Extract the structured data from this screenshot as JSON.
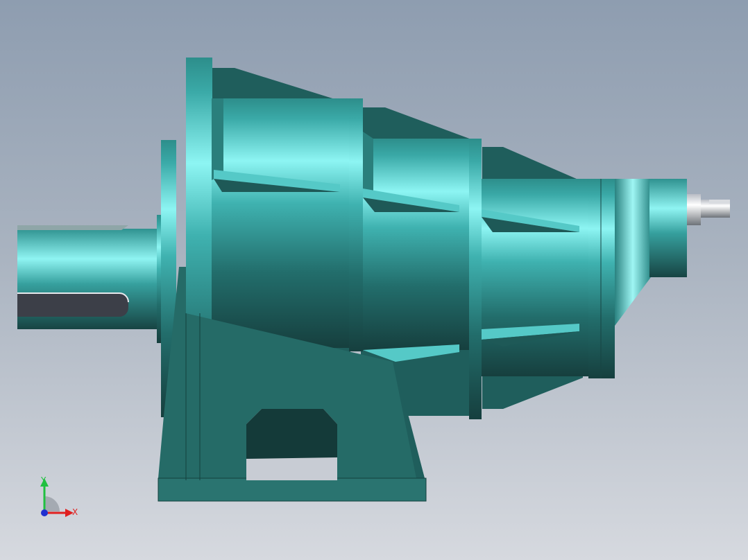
{
  "viewport": {
    "background_top": "#8e9db0",
    "background_bottom": "#d6d9df"
  },
  "model": {
    "icon": "planetary-gear-reducer-model",
    "color_body": "#2f8d89",
    "color_highlight": "#7ff0ef",
    "color_shadow": "#1d5553",
    "color_base": "#256b67"
  },
  "triad": {
    "x_label": "X",
    "y_label": "Y",
    "x_color": "#e02020",
    "y_color": "#20c040",
    "z_color": "#2030d0"
  }
}
